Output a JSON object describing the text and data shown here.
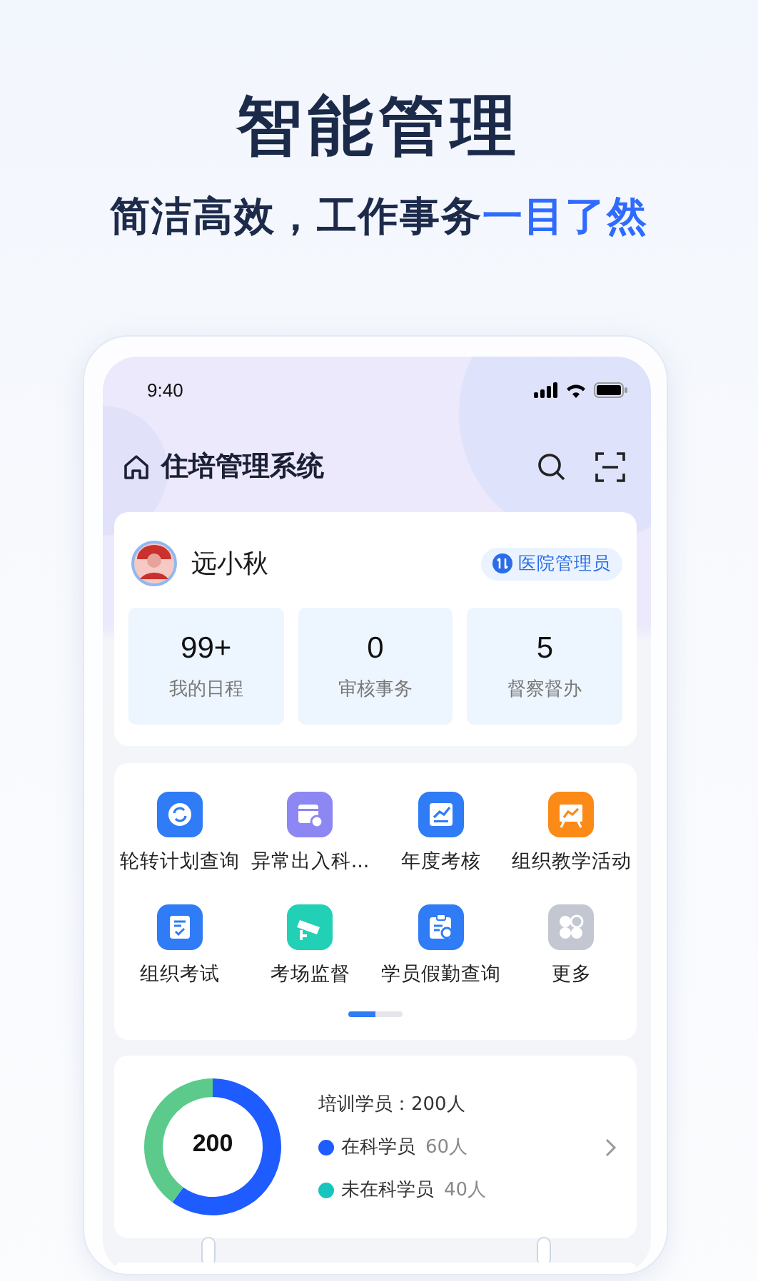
{
  "hero": {
    "title": "智能管理",
    "subtitle": "简洁高效，工作事务",
    "subtitle_highlight": "一目了然"
  },
  "status_bar": {
    "time": "9:40"
  },
  "header": {
    "title": "住培管理系统"
  },
  "user": {
    "name": "远小秋",
    "role": "医院管理员"
  },
  "summary": [
    {
      "value": "99+",
      "label": "我的日程"
    },
    {
      "value": "0",
      "label": "审核事务"
    },
    {
      "value": "5",
      "label": "督察督办"
    }
  ],
  "menu": [
    {
      "label": "轮转计划查询",
      "color": "#2f7cf6"
    },
    {
      "label": "异常出入科...",
      "color": "#8d87f4"
    },
    {
      "label": "年度考核",
      "color": "#2f7cf6"
    },
    {
      "label": "组织教学活动",
      "color": "#fb8a16"
    },
    {
      "label": "组织考试",
      "color": "#2f7cf6"
    },
    {
      "label": "考场监督",
      "color": "#22d0b6"
    },
    {
      "label": "学员假勤查询",
      "color": "#2f7cf6"
    },
    {
      "label": "更多",
      "color": "#c3c7d1"
    }
  ],
  "menu_pages": [
    {
      "selected": true
    },
    {
      "selected": false
    }
  ],
  "trainees": {
    "title": "培训学员：200人",
    "center_label": "200",
    "chart_data": {
      "type": "donut",
      "categories": [
        "在科学员",
        "未在科学员"
      ],
      "values": [
        60,
        40
      ]
    },
    "legend": [
      {
        "count": "60人",
        "color": "#1f5cff"
      },
      {
        "count": "40人",
        "color": "#16c6bd"
      }
    ]
  }
}
